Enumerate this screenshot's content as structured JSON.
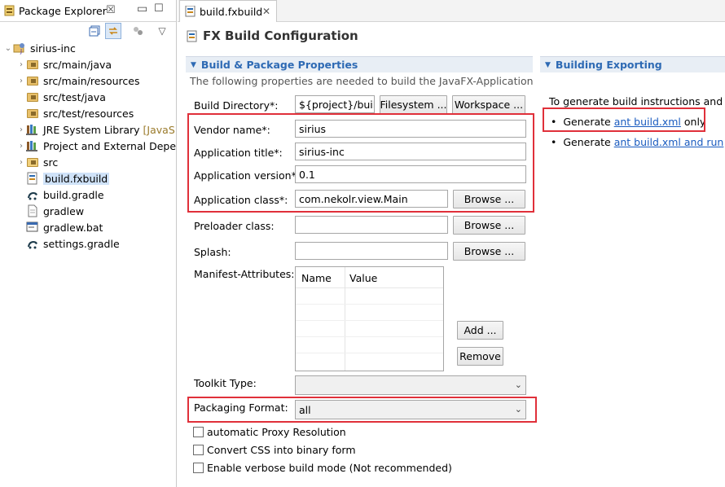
{
  "explorer": {
    "tab_title": "Package Explorer",
    "tree": [
      {
        "label": "sirius-inc",
        "suffix": "",
        "icon": "project-icon",
        "expanded": true
      },
      {
        "label": "src/main/java",
        "suffix": "",
        "icon": "package-folder-icon"
      },
      {
        "label": "src/main/resources",
        "suffix": "",
        "icon": "package-folder-icon"
      },
      {
        "label": "src/test/java",
        "suffix": "",
        "icon": "package-folder-icon"
      },
      {
        "label": "src/test/resources",
        "suffix": "",
        "icon": "package-folder-icon"
      },
      {
        "label": "JRE System Library",
        "suffix": "[JavaSE",
        "icon": "library-icon"
      },
      {
        "label": "Project and External Deper",
        "suffix": "",
        "icon": "library-icon"
      },
      {
        "label": "src",
        "suffix": "",
        "icon": "folder-icon"
      },
      {
        "label": "build.fxbuild",
        "suffix": "",
        "icon": "fxbuild-file-icon",
        "selected": true
      },
      {
        "label": "build.gradle",
        "suffix": "",
        "icon": "gradle-icon"
      },
      {
        "label": "gradlew",
        "suffix": "",
        "icon": "file-icon"
      },
      {
        "label": "gradlew.bat",
        "suffix": "",
        "icon": "batch-file-icon"
      },
      {
        "label": "settings.gradle",
        "suffix": "",
        "icon": "gradle-icon"
      }
    ]
  },
  "editor": {
    "tab_title": "build.fxbuild",
    "header_title": "FX Build Configuration",
    "left_section": {
      "title": "Build & Package Properties",
      "description": "The following properties are needed to build the JavaFX-Application",
      "build_directory": {
        "label": "Build Directory*:",
        "value": "${project}/build",
        "filesystem_btn": "Filesystem ...",
        "workspace_btn": "Workspace ..."
      },
      "vendor_name": {
        "label": "Vendor name*:",
        "value": "sirius"
      },
      "app_title": {
        "label": "Application title*:",
        "value": "sirius-inc"
      },
      "app_version": {
        "label": "Application version*:",
        "value": "0.1"
      },
      "app_class": {
        "label": "Application class*:",
        "value": "com.nekolr.view.Main",
        "browse_btn": "Browse ..."
      },
      "preloader_class": {
        "label": "Preloader class:",
        "value": "",
        "browse_btn": "Browse ..."
      },
      "splash": {
        "label": "Splash:",
        "value": "",
        "browse_btn": "Browse ..."
      },
      "manifest": {
        "label": "Manifest-Attributes:",
        "col_name": "Name",
        "col_value": "Value",
        "add_btn": "Add ...",
        "remove_btn": "Remove"
      },
      "toolkit_type": {
        "label": "Toolkit Type:",
        "value": ""
      },
      "packaging_format": {
        "label": "Packaging Format:",
        "value": "all"
      },
      "checkboxes": [
        {
          "label": "automatic Proxy Resolution",
          "checked": false
        },
        {
          "label": "Convert CSS into binary form",
          "checked": false
        },
        {
          "label": "Enable verbose build mode (Not recommended)",
          "checked": false
        }
      ]
    },
    "right_section": {
      "title": "Building  Exporting",
      "intro": "To generate build instructions and ex",
      "item1": {
        "prefix": "Generate ",
        "link": "ant build.xml",
        "suffix": " only"
      },
      "item2": {
        "prefix": "Generate ",
        "link": "ant build.xml and run",
        "suffix": ""
      }
    }
  },
  "colors": {
    "highlight_box": "#e0303a",
    "section_title": "#2e6ab4",
    "link": "#1a5bbf",
    "selection": "#cfe2f8"
  }
}
